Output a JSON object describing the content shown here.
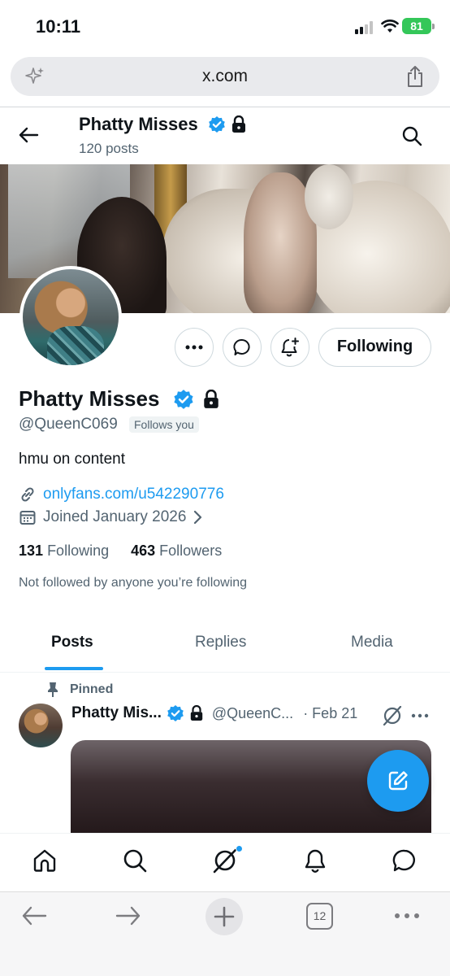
{
  "status_bar": {
    "time": "10:11",
    "battery": "81"
  },
  "browser": {
    "url": "x.com",
    "tab_count": "12"
  },
  "header": {
    "name": "Phatty Misses",
    "post_count": "120 posts"
  },
  "profile": {
    "display_name": "Phatty Misses",
    "handle": "@QueenC069",
    "follows_you_label": "Follows you",
    "bio": "hmu on content",
    "link": "onlyfans.com/u542290776",
    "joined": "Joined January 2026",
    "following_count": "131",
    "following_label": "Following",
    "followers_count": "463",
    "followers_label": "Followers",
    "not_followed_note": "Not followed by anyone you’re following",
    "follow_button_label": "Following"
  },
  "tabs": [
    {
      "label": "Posts",
      "active": true
    },
    {
      "label": "Replies",
      "active": false
    },
    {
      "label": "Media",
      "active": false
    }
  ],
  "pinned_post": {
    "pinned_label": "Pinned",
    "name": "Phatty Mis...",
    "handle": "@QueenC...",
    "date": "· Feb 21"
  },
  "colors": {
    "accent": "#1d9bf0",
    "text": "#0f1419",
    "secondary_text": "#536471",
    "battery": "#34c759"
  },
  "icons": {
    "bottom_nav": [
      "home-icon",
      "search-icon",
      "grok-icon",
      "bell-icon",
      "messages-icon"
    ],
    "browser_toolbar": [
      "back-arrow-icon",
      "forward-arrow-icon",
      "plus-icon",
      "tabs-icon",
      "more-icon"
    ]
  }
}
